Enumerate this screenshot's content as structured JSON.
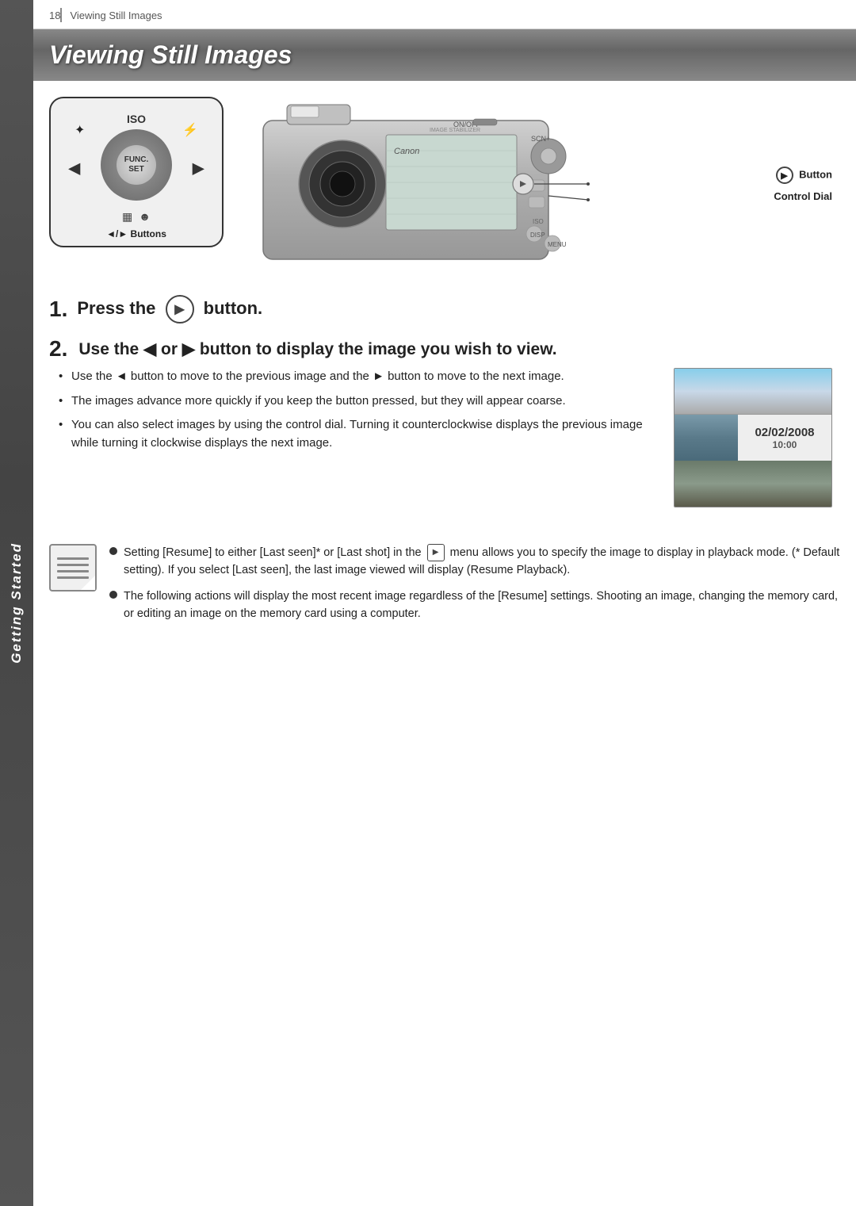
{
  "sidebar": {
    "label": "Getting Started"
  },
  "page_header": {
    "page_num": "18",
    "section": "Viewing Still Images"
  },
  "chapter_title": "Viewing Still Images",
  "camera_diagram": {
    "left_label": "ISO",
    "func_set_label": "FUNC.\nSET",
    "buttons_label": "◄/► Buttons",
    "button_label": "Button",
    "control_dial_label": "Control Dial"
  },
  "step1": {
    "prefix": "Press the",
    "suffix": "button.",
    "step_num": "1."
  },
  "step2": {
    "step_num": "2.",
    "heading": "Use the ◄ or ► button to display the image you wish to view.",
    "bullets": [
      "Use the ◄ button to move to the previous image and the ► button to move to the next image.",
      "The images advance more quickly if you keep the button pressed, but they will appear coarse.",
      "You can also select images by using the control dial. Turning it counterclockwise displays the previous image while turning it clockwise displays the next image."
    ]
  },
  "thumbnail": {
    "date": "02/02/2008",
    "time": "10:00"
  },
  "notes": [
    {
      "text": "Setting [Resume] to either [Last seen]* or [Last shot] in the  menu allows you to specify the image to display in playback mode. (* Default setting). If you select [Last seen], the last image viewed will display (Resume Playback)."
    },
    {
      "text": "The following actions will display the most recent image regardless of the [Resume] settings. Shooting an image, changing the memory card, or editing an image on the memory card using a computer."
    }
  ]
}
